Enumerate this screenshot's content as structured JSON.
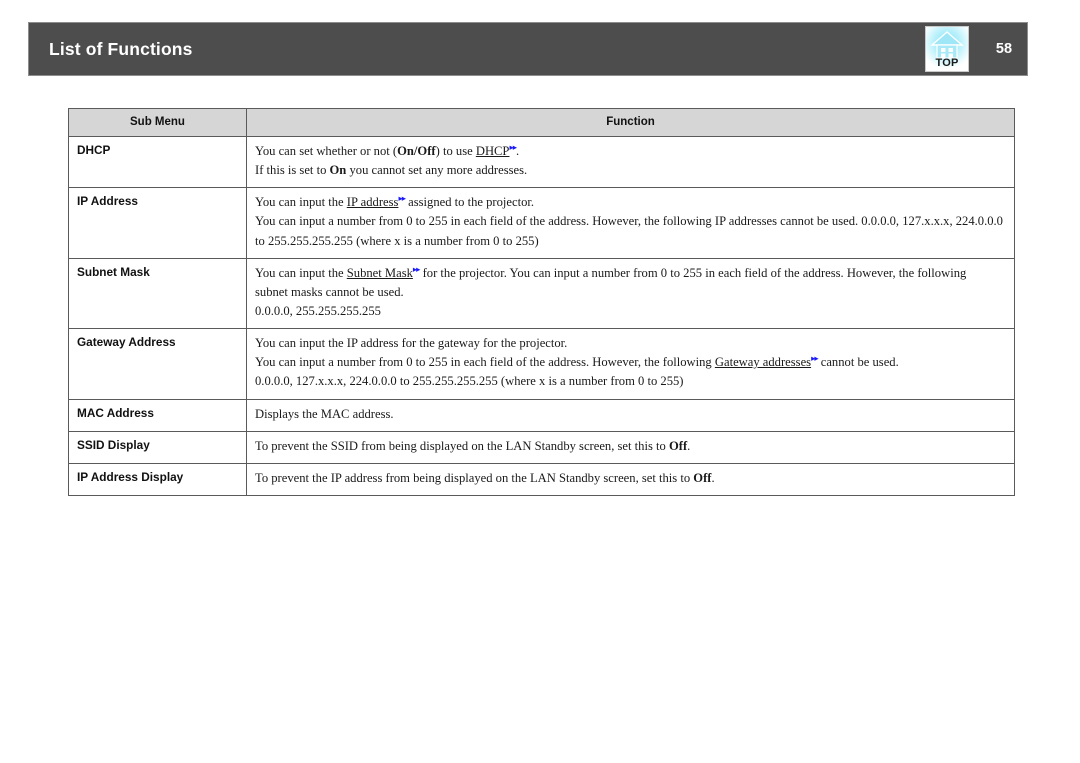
{
  "header": {
    "title": "List of Functions",
    "page_number": "58",
    "top_button_label": "TOP",
    "top_button_icon": "projector-top-icon",
    "bar_color": "#4d4d4d",
    "title_color": "#ffffff"
  },
  "table": {
    "columns": [
      "Sub Menu",
      "Function"
    ],
    "header_background": "#d6d6d6",
    "border_color": "#5a5a5a",
    "link_glyph": "▸▸",
    "link_color": "#1a1aff",
    "rows": [
      {
        "sub_menu": "DHCP",
        "lines": [
          [
            {
              "t": "You can set whether or not ("
            },
            {
              "t": "On/Off",
              "bold": true
            },
            {
              "t": ") to use "
            },
            {
              "t": "DHCP",
              "gloss": true
            },
            {
              "t": "",
              "jump": true
            },
            {
              "t": "."
            }
          ],
          [
            {
              "t": "If this is set to "
            },
            {
              "t": "On",
              "bold": true
            },
            {
              "t": " you cannot set any more addresses."
            }
          ]
        ]
      },
      {
        "sub_menu": "IP Address",
        "lines": [
          [
            {
              "t": "You can input the "
            },
            {
              "t": "IP address",
              "gloss": true
            },
            {
              "t": "",
              "jump": true
            },
            {
              "t": " assigned to the projector."
            }
          ],
          [
            {
              "t": "You can input a number from 0 to 255 in each field of the address. However, the following IP addresses cannot be used. 0.0.0.0, 127.x.x.x, 224.0.0.0"
            }
          ],
          [
            {
              "t": "to 255.255.255.255 (where x is a number from 0 to 255)"
            }
          ]
        ]
      },
      {
        "sub_menu": "Subnet Mask",
        "lines": [
          [
            {
              "t": "You can input the "
            },
            {
              "t": "Subnet Mask",
              "gloss": true
            },
            {
              "t": "",
              "jump": true
            },
            {
              "t": " for the projector. You can input a number from 0 to 255 in each field of the address. However, the following"
            }
          ],
          [
            {
              "t": "subnet masks cannot be used."
            }
          ],
          [
            {
              "t": "0.0.0.0, 255.255.255.255"
            }
          ]
        ]
      },
      {
        "sub_menu": "Gateway Address",
        "lines": [
          [
            {
              "t": "You can input the IP address for the gateway for the projector."
            }
          ],
          [
            {
              "t": "You can input a number from 0 to 255 in each field of the address. However, the following "
            },
            {
              "t": "Gateway addresses",
              "gloss": true
            },
            {
              "t": "",
              "jump": true
            },
            {
              "t": " cannot be used."
            }
          ],
          [
            {
              "t": "0.0.0.0, 127.x.x.x, 224.0.0.0 to 255.255.255.255 (where x is a number from 0 to 255)"
            }
          ]
        ]
      },
      {
        "sub_menu": "MAC Address",
        "lines": [
          [
            {
              "t": "Displays the MAC address."
            }
          ]
        ]
      },
      {
        "sub_menu": "SSID Display",
        "lines": [
          [
            {
              "t": "To prevent the SSID from being displayed on the LAN Standby screen, set this to "
            },
            {
              "t": "Off",
              "bold": true
            },
            {
              "t": "."
            }
          ]
        ]
      },
      {
        "sub_menu": "IP Address Display",
        "lines": [
          [
            {
              "t": "To prevent the IP address from being displayed on the LAN Standby screen, set this to "
            },
            {
              "t": "Off",
              "bold": true
            },
            {
              "t": "."
            }
          ]
        ]
      }
    ]
  }
}
